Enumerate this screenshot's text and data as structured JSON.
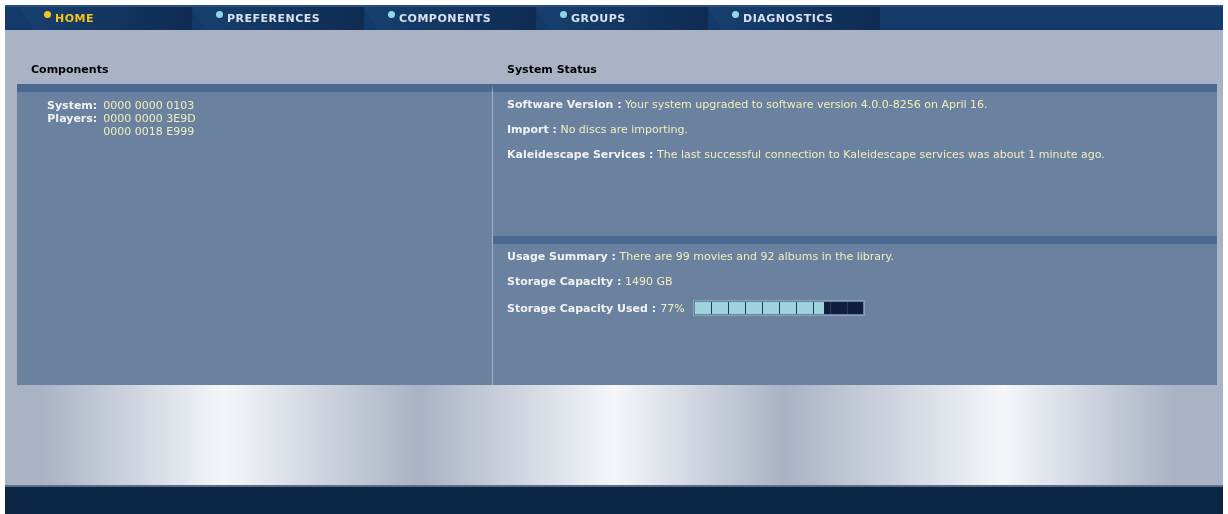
{
  "tabs": [
    {
      "label": "HOME",
      "selected": true
    },
    {
      "label": "PREFERENCES",
      "selected": false
    },
    {
      "label": "COMPONENTS",
      "selected": false
    },
    {
      "label": "GROUPS",
      "selected": false
    },
    {
      "label": "DIAGNOSTICS",
      "selected": false
    }
  ],
  "components": {
    "title": "Components",
    "rows": [
      {
        "label": "System:",
        "values": [
          "0000 0000 0103"
        ]
      },
      {
        "label": "Players:",
        "values": [
          "0000 0000 3E9D",
          "0000 0018 E999"
        ]
      }
    ]
  },
  "system_status": {
    "title": "System Status",
    "sections": [
      {
        "items": [
          {
            "label": "Software Version :",
            "value": "Your system upgraded to software version 4.0.0-8256 on April 16."
          },
          {
            "label": "Import :",
            "value": "No discs are importing."
          },
          {
            "label": "Kaleidescape Services :",
            "value": "The last successful connection to Kaleidescape services was about 1 minute ago."
          }
        ]
      },
      {
        "items": [
          {
            "label": "Usage Summary :",
            "value": "There are 99 movies and 92 albums in the library."
          },
          {
            "label": "Storage Capacity :",
            "value": "1490 GB"
          },
          {
            "label": "Storage Capacity Used :",
            "value": "77%",
            "kind": "meter",
            "level": 0.77
          }
        ]
      }
    ]
  }
}
